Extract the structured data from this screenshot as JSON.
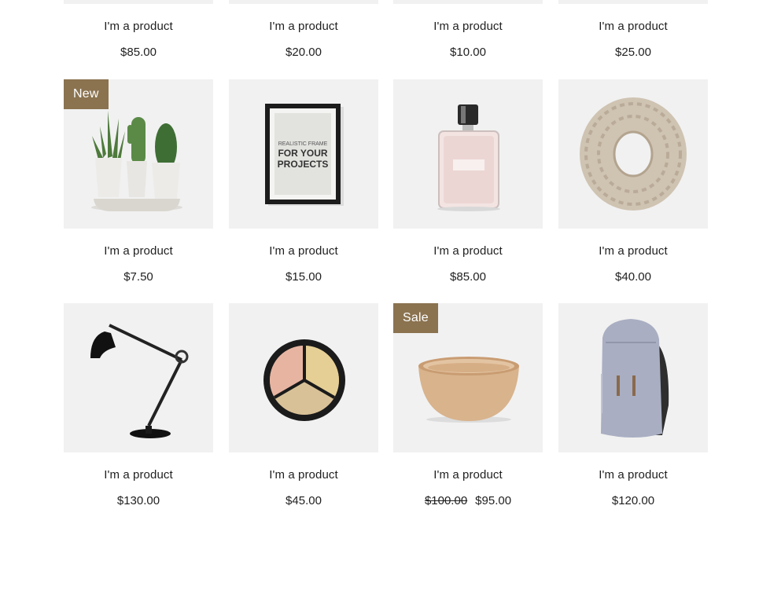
{
  "accent_color": "#8b7350",
  "products": [
    {
      "name": "I'm a product",
      "price": "$85.00"
    },
    {
      "name": "I'm a product",
      "price": "$20.00"
    },
    {
      "name": "I'm a product",
      "price": "$10.00"
    },
    {
      "name": "I'm a product",
      "price": "$25.00"
    },
    {
      "name": "I'm a product",
      "price": "$7.50",
      "ribbon": "New",
      "icon": "cactus-plants-icon"
    },
    {
      "name": "I'm a product",
      "price": "$15.00",
      "icon": "picture-frame-icon",
      "frame_lines": [
        "REALISTIC FRAME",
        "FOR YOUR",
        "PROJECTS"
      ]
    },
    {
      "name": "I'm a product",
      "price": "$85.00",
      "icon": "perfume-bottle-icon"
    },
    {
      "name": "I'm a product",
      "price": "$40.00",
      "icon": "knit-scarf-icon"
    },
    {
      "name": "I'm a product",
      "price": "$130.00",
      "icon": "desk-lamp-icon"
    },
    {
      "name": "I'm a product",
      "price": "$45.00",
      "icon": "makeup-palette-icon"
    },
    {
      "name": "I'm a product",
      "price": "$95.00",
      "old_price": "$100.00",
      "ribbon": "Sale",
      "icon": "wooden-bowl-icon"
    },
    {
      "name": "I'm a product",
      "price": "$120.00",
      "icon": "backpack-icon"
    }
  ]
}
